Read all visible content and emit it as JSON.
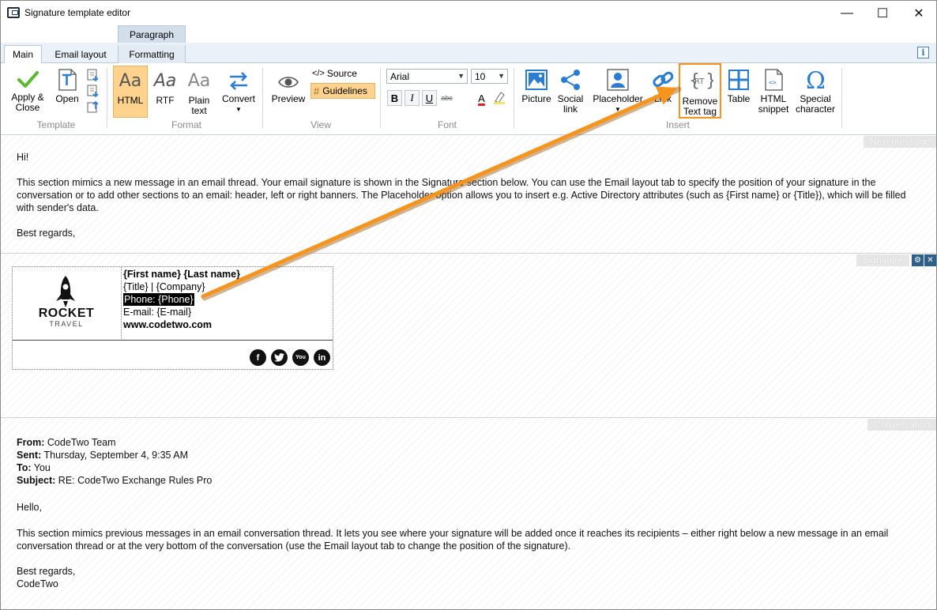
{
  "window": {
    "title": "Signature template editor",
    "minimize": "—",
    "maximize": "☐",
    "close": "✕"
  },
  "ribbon_tabs": {
    "context_group": "Paragraph",
    "main": "Main",
    "email_layout": "Email layout",
    "formatting": "Formatting",
    "info": "i"
  },
  "groups": {
    "template": {
      "label": "Template",
      "apply_close": "Apply &\nClose",
      "open": "Open"
    },
    "format": {
      "label": "Format",
      "html": "HTML",
      "rtf": "RTF",
      "plain_text": "Plain\ntext",
      "convert": "Convert",
      "aa": "Aa"
    },
    "view": {
      "label": "View",
      "preview": "Preview",
      "source": "Source",
      "guidelines": "Guidelines"
    },
    "font": {
      "label": "Font",
      "family": "Arial",
      "size": "10",
      "bold": "B",
      "italic": "I",
      "underline": "U",
      "strike": "abc",
      "color": "A"
    },
    "insert": {
      "label": "Insert",
      "picture": "Picture",
      "social_link": "Social\nlink",
      "placeholder": "Placeholder",
      "link": "Link",
      "remove_text_tag": "Remove\nText tag",
      "table": "Table",
      "html_snippet": "HTML\nsnippet",
      "special_character": "Special\ncharacter"
    }
  },
  "new_message": {
    "label": "New message",
    "greeting": "Hi!",
    "body": "This section mimics a new message in an email thread. Your email signature is shown in the Signature section below. You can use the Email layout tab to specify the position of your signature in the conversation or to add other sections to an email: header, left or right banners. The Placeholder option allows you to insert e.g. Active Directory attributes (such as {First name} or {Title}), which will be filled with sender's data.",
    "closing": "Best regards,"
  },
  "signature": {
    "label": "Signature",
    "logo_main": "ROCKET",
    "logo_sub": "TRAVEL",
    "name": "{First name} {Last name}",
    "title_company": "{Title} | {Company}",
    "phone": "Phone: {Phone}",
    "email": "E-mail: {E-mail}",
    "website": "www.codetwo.com",
    "social": {
      "facebook": "f",
      "youtube": "You",
      "linkedin": "in"
    }
  },
  "conversation": {
    "label": "Conversation",
    "from_label": "From:",
    "from_value": "CodeTwo Team",
    "sent_label": "Sent:",
    "sent_value": "Thursday, September 4, 9:35 AM",
    "to_label": "To:",
    "to_value": "You",
    "subject_label": "Subject:",
    "subject_value": "RE: CodeTwo Exchange Rules Pro",
    "greeting": "Hello,",
    "body": "This section mimics previous messages in an email conversation thread. It lets you see where your signature will be added once it reaches its recipients – either right below a new message in an email conversation thread or at the very bottom of the conversation (use the Email layout tab to change the position of the signature).",
    "closing": "Best regards,",
    "signoff": "CodeTwo"
  },
  "colors": {
    "accent_highlight": "#ffd38d",
    "callout_arrow": "#f7941d",
    "ribbon_icon_blue": "#2b7cd3"
  }
}
